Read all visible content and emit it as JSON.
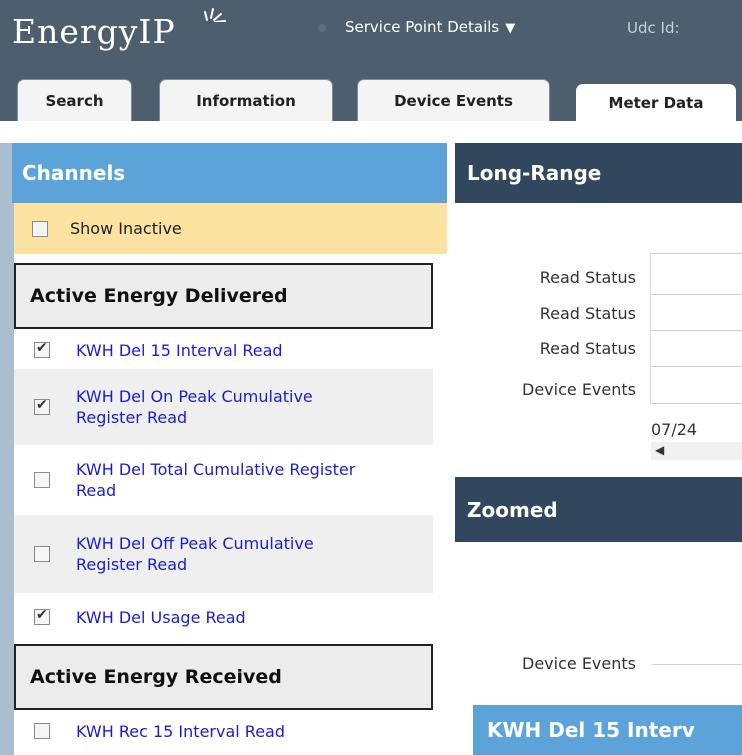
{
  "header": {
    "logo": "EnergyIP",
    "page_select": "Service Point Details",
    "udc_label": "Udc Id:"
  },
  "tabs": [
    {
      "label": "Search"
    },
    {
      "label": "Information"
    },
    {
      "label": "Device Events"
    },
    {
      "label": "Meter Data",
      "active": true
    }
  ],
  "channels": {
    "title": "Channels",
    "show_inactive": {
      "label": "Show Inactive",
      "checked": false
    },
    "sections": [
      {
        "title": "Active Energy Delivered",
        "items": [
          {
            "label": "KWH Del 15 Interval Read",
            "checked": true
          },
          {
            "label": "KWH Del On Peak Cumulative Register Read",
            "checked": true
          },
          {
            "label": "KWH Del Total Cumulative Register Read",
            "checked": false
          },
          {
            "label": "KWH Del Off Peak Cumulative Register Read",
            "checked": false
          },
          {
            "label": "KWH Del Usage Read",
            "checked": true
          }
        ]
      },
      {
        "title": "Active Energy Received",
        "items": [
          {
            "label": "KWH Rec 15 Interval Read",
            "checked": false
          }
        ]
      }
    ]
  },
  "long_range": {
    "title": "Long-Range",
    "rows": [
      "Read Status",
      "Read Status",
      "Read Status",
      "Device Events"
    ],
    "date": "07/24"
  },
  "zoomed": {
    "title": "Zoomed",
    "rows": [
      "Device Events"
    ]
  },
  "detail_card": {
    "title": "KWH Del 15 Interv"
  },
  "colors": {
    "header_bg": "#4d5e6f",
    "panel_header_blue": "#5ba3d9",
    "dark_bar": "#30475e",
    "highlight_yellow": "#fbe2a0",
    "link_blue": "#1c1ccc"
  }
}
